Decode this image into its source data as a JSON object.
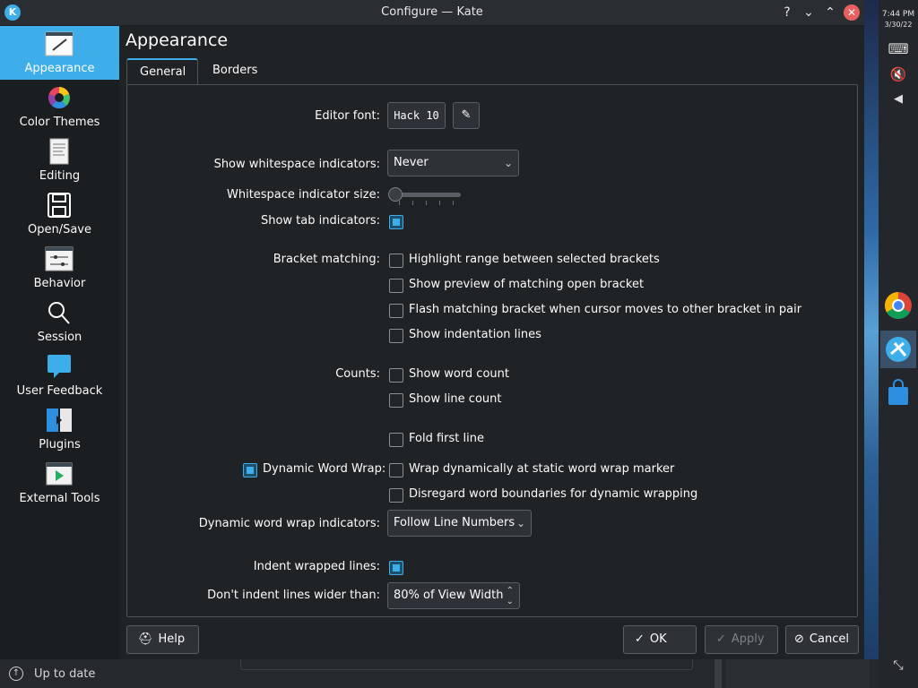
{
  "window": {
    "title": "Configure — Kate"
  },
  "sidebar": {
    "items": [
      {
        "label": "Appearance",
        "active": true
      },
      {
        "label": "Color Themes"
      },
      {
        "label": "Editing"
      },
      {
        "label": "Open/Save"
      },
      {
        "label": "Behavior"
      },
      {
        "label": "Session"
      },
      {
        "label": "User Feedback"
      },
      {
        "label": "Plugins"
      },
      {
        "label": "External Tools"
      }
    ]
  },
  "page": {
    "title": "Appearance",
    "tabs": [
      {
        "label": "General",
        "active": true
      },
      {
        "label": "Borders"
      }
    ]
  },
  "form": {
    "editor_font_label": "Editor font:",
    "editor_font_value": "Hack 10",
    "whitespace_label": "Show whitespace indicators:",
    "whitespace_value": "Never",
    "whitespace_size_label": "Whitespace indicator size:",
    "whitespace_size_level": 0,
    "tab_indicators_label": "Show tab indicators:",
    "tab_indicators_checked": true,
    "bracket_label": "Bracket matching:",
    "bracket_options": [
      {
        "text": "Highlight range between selected brackets",
        "checked": false
      },
      {
        "text": "Show preview of matching open bracket",
        "checked": false
      },
      {
        "text": "Flash matching bracket when cursor moves to other bracket in pair",
        "checked": false
      },
      {
        "text": "Show indentation lines",
        "checked": false
      }
    ],
    "counts_label": "Counts:",
    "count_options": [
      {
        "text": "Show word count",
        "checked": false
      },
      {
        "text": "Show line count",
        "checked": false
      }
    ],
    "fold_first_line": "Fold first line",
    "dynamic_wrap_label": "Dynamic Word Wrap:",
    "dynamic_wrap_checked": true,
    "wrap_options": [
      {
        "text": "Wrap dynamically at static word wrap marker",
        "checked": false
      },
      {
        "text": "Disregard word boundaries for dynamic wrapping",
        "checked": false
      }
    ],
    "wrap_indicators_label": "Dynamic word wrap indicators:",
    "wrap_indicators_value": "Follow Line Numbers",
    "indent_wrapped_label": "Indent wrapped lines:",
    "indent_wrapped_checked": true,
    "dont_indent_label": "Don't indent lines wider than:",
    "dont_indent_value": "80% of View Width"
  },
  "footer": {
    "help": "Help",
    "ok": "OK",
    "apply": "Apply",
    "cancel": "Cancel"
  },
  "statusbar": {
    "text": "Up to date"
  },
  "tray": {
    "time": "7:44 PM",
    "date": "3/30/22"
  },
  "colors": {
    "accent": "#3daee9",
    "background": "#202326",
    "sidebar": "#1b1e20"
  }
}
